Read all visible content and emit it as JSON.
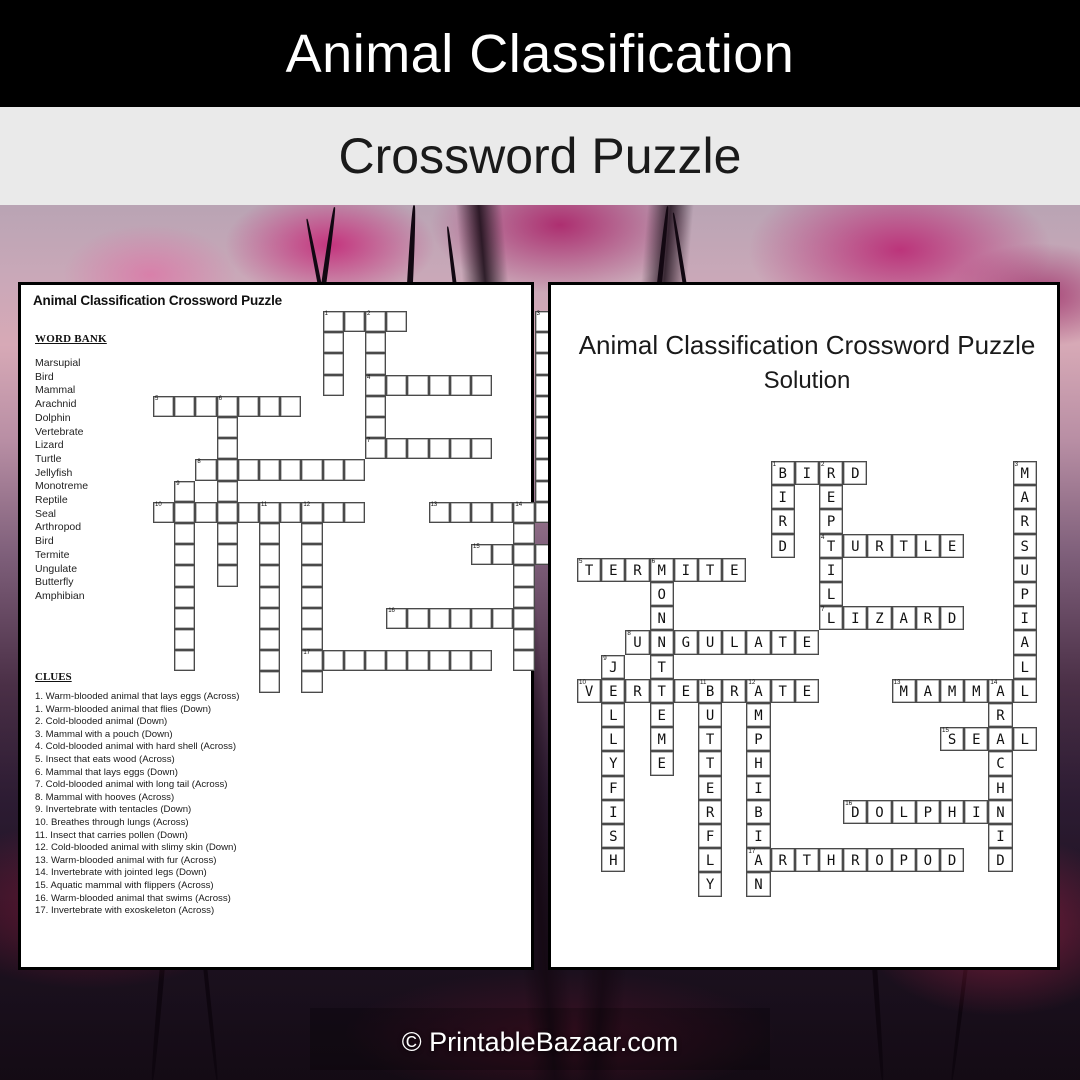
{
  "header": {
    "title": "Animal Classification",
    "subtitle": "Crossword Puzzle"
  },
  "footer": {
    "watermark": "© PrintableBazaar.com"
  },
  "colors": {
    "band_top_bg": "#000000",
    "band_top_text": "#ffffff",
    "band_sub_bg": "#eaeaea",
    "band_sub_text": "#1a1a1a",
    "card_bg": "#ffffff",
    "card_border": "#000000",
    "cell_border": "#4a4a4a",
    "background_accent": "#c52476"
  },
  "puzzle_panel": {
    "heading": "Animal Classification Crossword Puzzle",
    "word_bank_title": "WORD BANK",
    "word_bank": [
      "Marsupial",
      "Bird",
      "Mammal",
      "Arachnid",
      "Dolphin",
      "Vertebrate",
      "Lizard",
      "Turtle",
      "Jellyfish",
      "Monotreme",
      "Reptile",
      "Seal",
      "Arthropod",
      "Bird",
      "Termite",
      "Ungulate",
      "Butterfly",
      "Amphibian"
    ],
    "clues_title": "CLUES",
    "clues": [
      "1. Warm-blooded  animal that lays eggs (Across)",
      "1. Warm-blooded  animal that flies (Down)",
      "2. Cold-blooded animal (Down)",
      "3. Mammal with a pouch (Down)",
      "4. Cold-blooded animal with hard shell (Across)",
      "5. Insect that eats wood (Across)",
      "6. Mammal that lays eggs (Down)",
      "7. Cold-blooded animal with long tail (Across)",
      "8. Mammal with hooves (Across)",
      "9. Invertebrate with tentacles (Down)",
      "10. Breathes through lungs (Across)",
      "11. Insect that carries pollen (Down)",
      "12. Cold-blooded animal with slimy skin (Down)",
      "13. Warm-blooded  animal with fur (Across)",
      "14. Invertebrate with jointed legs (Down)",
      "15. Aquatic mammal with flippers (Across)",
      "16. Warm-blooded  animal that swims (Across)",
      "17. Invertebrate with exoskeleton (Across)"
    ]
  },
  "solution_panel": {
    "heading_line1": "Animal Classification Crossword",
    "heading_line2": "Puzzle",
    "heading_line3": "Solution"
  },
  "crossword": {
    "columns": 19,
    "rows": 18,
    "entries": [
      {
        "number": 1,
        "answer": "BIRD",
        "direction": "across",
        "row": 0,
        "col": 8
      },
      {
        "number": 1,
        "answer": "BIRD",
        "direction": "down",
        "row": 0,
        "col": 8
      },
      {
        "number": 2,
        "answer": "REPTILE",
        "direction": "down",
        "row": 0,
        "col": 10
      },
      {
        "number": 3,
        "answer": "MARSUPIAL",
        "direction": "down",
        "row": 0,
        "col": 18
      },
      {
        "number": 4,
        "answer": "TURTLE",
        "direction": "across",
        "row": 3,
        "col": 10
      },
      {
        "number": 5,
        "answer": "TERMITE",
        "direction": "across",
        "row": 4,
        "col": 0
      },
      {
        "number": 6,
        "answer": "MONOTREME",
        "direction": "down",
        "row": 4,
        "col": 3
      },
      {
        "number": 7,
        "answer": "LIZARD",
        "direction": "across",
        "row": 6,
        "col": 10
      },
      {
        "number": 8,
        "answer": "UNGULATE",
        "direction": "across",
        "row": 7,
        "col": 2
      },
      {
        "number": 9,
        "answer": "JELLYFISH",
        "direction": "down",
        "row": 8,
        "col": 1
      },
      {
        "number": 10,
        "answer": "VERTEBRATE",
        "direction": "across",
        "row": 9,
        "col": 0
      },
      {
        "number": 11,
        "answer": "BUTTERFLY",
        "direction": "down",
        "row": 9,
        "col": 5
      },
      {
        "number": 12,
        "answer": "AMPHIBIAN",
        "direction": "down",
        "row": 9,
        "col": 7
      },
      {
        "number": 13,
        "answer": "MAMMAL",
        "direction": "across",
        "row": 9,
        "col": 13
      },
      {
        "number": 14,
        "answer": "ARACHNID",
        "direction": "down",
        "row": 9,
        "col": 17
      },
      {
        "number": 15,
        "answer": "SEAL",
        "direction": "across",
        "row": 11,
        "col": 15
      },
      {
        "number": 16,
        "answer": "DOLPHIN",
        "direction": "across",
        "row": 14,
        "col": 11
      },
      {
        "number": 17,
        "answer": "ARTHROPOD",
        "direction": "across",
        "row": 16,
        "col": 7
      }
    ]
  }
}
